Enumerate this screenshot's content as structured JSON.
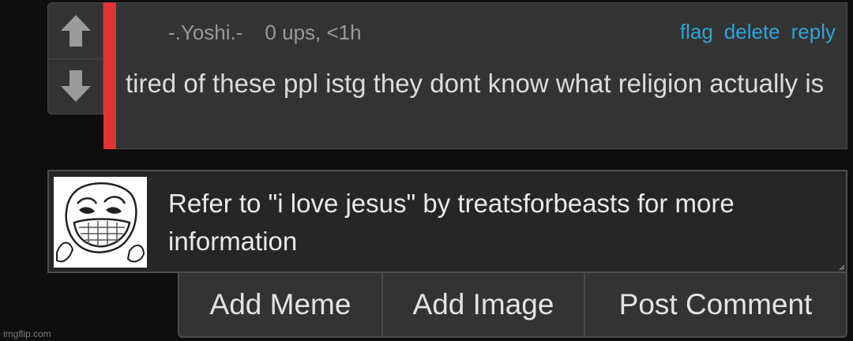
{
  "comment": {
    "username": "-.Yoshi.-",
    "points": "0 ups, <1h",
    "actions": {
      "flag": "flag",
      "delete": "delete",
      "reply": "reply"
    },
    "text": "tired of these ppl istg they dont know what religion actually is"
  },
  "reply": {
    "avatar_icon": "trollface-meme-image",
    "text": "Refer to \"i love jesus\" by treatsforbeasts for more information"
  },
  "buttons": {
    "add_meme": "Add Meme",
    "add_image": "Add Image",
    "post_comment": "Post Comment"
  },
  "watermark": "imgflip.com",
  "colors": {
    "link": "#2fa4d8",
    "flag_strip": "#e03434",
    "panel": "#333333",
    "background": "#0e0e0e"
  }
}
